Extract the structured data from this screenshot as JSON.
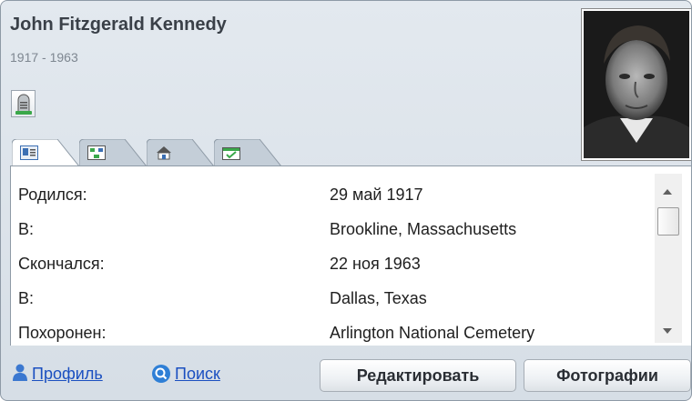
{
  "person": {
    "name": "John Fitzgerald Kennedy",
    "years": "1917 - 1963"
  },
  "icons": {
    "grave": "gravestone-icon",
    "tab_info": "id-card-icon",
    "tab_family": "family-tree-icon",
    "tab_home": "house-icon",
    "tab_events": "calendar-icon",
    "profile": "person-icon",
    "search": "search-icon"
  },
  "details": {
    "rows": [
      {
        "label": "Родился:",
        "value": "29 май 1917"
      },
      {
        "label": "В:",
        "value": "Brookline, Massachusetts"
      },
      {
        "label": "Скончался:",
        "value": "22 ноя 1963"
      },
      {
        "label": "В:",
        "value": "Dallas, Texas"
      },
      {
        "label": "Похоронен:",
        "value": "Arlington National Cemetery"
      }
    ]
  },
  "footer": {
    "profile_link": "Профиль",
    "search_link": "Поиск",
    "edit_button": "Редактировать",
    "photos_button": "Фотографии"
  },
  "colors": {
    "link": "#1a4fc0",
    "card_bg": "#dde4eb",
    "grave_green": "#3aa84a"
  }
}
